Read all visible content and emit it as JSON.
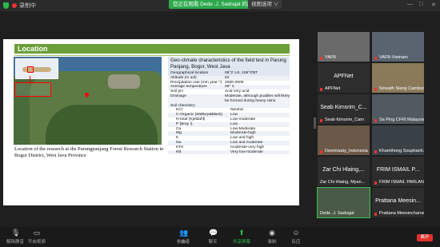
{
  "topbar": {
    "recording_label": "录制中",
    "sharing_banner": "您正在观看 Dede .J. Sadrajat 的屏幕",
    "view_options": "视图选项 ∨",
    "win_controls": [
      "—",
      "□",
      "✕"
    ]
  },
  "slide": {
    "title": "Location",
    "caption": "Location of the research at the Parungpanjang Forest Research Station in Bogor District, West Java Province",
    "table_title": "Geo-climate characteristics of the field test in Parung Panjang, Bogor, West Java",
    "rows": [
      {
        "k": "Geographical location",
        "v": "06°2' LS, 106°0'BT"
      },
      {
        "k": "Altitude (m asl)",
        "v": "52"
      },
      {
        "k": "Precipitation rate (mm year⁻¹)",
        "v": "2000-2500"
      },
      {
        "k": "Average temperature",
        "v": "28° C"
      },
      {
        "k": "Soil pH",
        "v": "Acid very acid"
      },
      {
        "k": "Drainage",
        "v": "Moderate, although puddles will likely be formed during heavy rains"
      },
      {
        "k": "",
        "v": ""
      },
      {
        "k": "Soil chemistry:",
        "v": ""
      },
      {
        "k": "KCl",
        "v": "Neutral"
      },
      {
        "k": "C-Organic (Walkey&Black)",
        "v": "Low"
      },
      {
        "k": "N-total (Kjeldahl)",
        "v": "Low-moderate"
      },
      {
        "k": "P (Bray I)",
        "v": "Low"
      },
      {
        "k": "Ca",
        "v": "Low-Moderate"
      },
      {
        "k": "Mg",
        "v": "Moderate-high"
      },
      {
        "k": "K",
        "v": "Low and high"
      },
      {
        "k": "Na",
        "v": "Low and moderate"
      },
      {
        "k": "KTK",
        "v": "moderate-very high"
      },
      {
        "k": "KB",
        "v": "Very low-moderate"
      }
    ]
  },
  "participants": [
    {
      "name": "YAFB",
      "mic_off": true,
      "big": ""
    },
    {
      "name": "VAFB-Vietnam",
      "mic_off": true,
      "big": ""
    },
    {
      "name": "APFNet",
      "mic_off": true,
      "big": "APFNet"
    },
    {
      "name": "Smeath Sieng Cambodia",
      "mic_off": true,
      "big": ""
    },
    {
      "name": "Seab Kimsrim_Cam",
      "mic_off": true,
      "big": "Seab Kimsrim_C..."
    },
    {
      "name": "Sa Ping CFRI Malaysia",
      "mic_off": true,
      "big": ""
    },
    {
      "name": "Desmiwaty_Indonesia",
      "mic_off": true,
      "big": ""
    },
    {
      "name": "Khamthong Souphanh...",
      "mic_off": true,
      "big": ""
    },
    {
      "name": "Zar Chi Hlaing, Myan...",
      "mic_off": false,
      "big": "Zar Chi Hlaing,..."
    },
    {
      "name": "FRIM ISMAIL PARLAN",
      "mic_off": true,
      "big": "FRIM ISMAIL P..."
    },
    {
      "name": "Dede .J. Sadrajat",
      "mic_off": false,
      "big": ""
    },
    {
      "name": "Prattana Meesincharoen",
      "mic_off": true,
      "big": "Prattana Meesin..."
    }
  ],
  "toolbar": {
    "mic_label": "解除静音",
    "video_label": "开启视频",
    "participants_label": "参会者",
    "participants_count": "29",
    "chat_label": "聊天",
    "share_label": "共享屏幕",
    "record_label": "录制",
    "reactions_label": "反应",
    "leave_label": "离开"
  }
}
